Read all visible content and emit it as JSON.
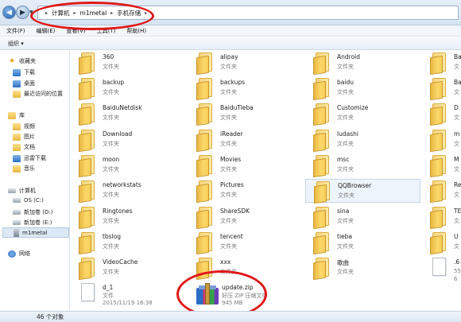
{
  "address": {
    "breadcrumbs": [
      "计算机",
      "m1metal",
      "手机存储"
    ]
  },
  "menu": [
    "文件(F)",
    "编辑(E)",
    "查看(V)",
    "工具(T)",
    "帮助(H)"
  ],
  "toolbar": {
    "organize_label": "组织 ▾"
  },
  "nav": {
    "favorites": "收藏夹",
    "download": "下载",
    "desktop": "桌面",
    "recent": "最近访问的位置",
    "library": "库",
    "video": "视频",
    "pictures": "图片",
    "docs": "文档",
    "xunlei": "迅雷下载",
    "music": "音乐",
    "computer": "计算机",
    "drive_c": "OS (C:)",
    "drive_d": "新加卷 (D:)",
    "drive_e": "新加卷 (E:)",
    "device": "m1metal",
    "network": "网络"
  },
  "items": [
    {
      "name": "360",
      "type": "文件夹"
    },
    {
      "name": "alipay",
      "type": "文件夹"
    },
    {
      "name": "Android",
      "type": "文件夹"
    },
    {
      "name": "Ba",
      "type": "文"
    },
    {
      "name": "backup",
      "type": "文件夹"
    },
    {
      "name": "backups",
      "type": "文件夹"
    },
    {
      "name": "baidu",
      "type": "文件夹"
    },
    {
      "name": "Ba",
      "type": "文"
    },
    {
      "name": "BaiduNetdisk",
      "type": "文件夹"
    },
    {
      "name": "BaiduTieba",
      "type": "文件夹"
    },
    {
      "name": "Customize",
      "type": "文件夹"
    },
    {
      "name": "D",
      "type": "文"
    },
    {
      "name": "Download",
      "type": "文件夹"
    },
    {
      "name": "iReader",
      "type": "文件夹"
    },
    {
      "name": "ludashi",
      "type": "文件夹"
    },
    {
      "name": "m",
      "type": "文"
    },
    {
      "name": "moon",
      "type": "文件夹"
    },
    {
      "name": "Movies",
      "type": "文件夹"
    },
    {
      "name": "msc",
      "type": "文件夹"
    },
    {
      "name": "M",
      "type": "文"
    },
    {
      "name": "networkstats",
      "type": "文件夹"
    },
    {
      "name": "Pictures",
      "type": "文件夹"
    },
    {
      "name": "QQBrowser",
      "type": "文件夹"
    },
    {
      "name": "Re",
      "type": "文"
    },
    {
      "name": "Ringtones",
      "type": "文件夹"
    },
    {
      "name": "ShareSDK",
      "type": "文件夹"
    },
    {
      "name": "sina",
      "type": "文件夹"
    },
    {
      "name": "TE",
      "type": "文"
    },
    {
      "name": "tbslog",
      "type": "文件夹"
    },
    {
      "name": "tencent",
      "type": "文件夹"
    },
    {
      "name": "tieba",
      "type": "文件夹"
    },
    {
      "name": "U",
      "type": "文"
    },
    {
      "name": "VideoCache",
      "type": "文件夹"
    },
    {
      "name": "xxx",
      "type": "文件夹"
    },
    {
      "name": "歌曲",
      "type": "文件夹"
    },
    {
      "name": ".6",
      "type": "55",
      "size": "6"
    }
  ],
  "file_d1": {
    "name": "d_1",
    "type": "文件",
    "date": "2015/11/19 16:38"
  },
  "file_update": {
    "name": "update.zip",
    "type": "好压 ZIP 压缩文件",
    "size": "945 MB"
  },
  "status": {
    "count_text": "46 个对象"
  },
  "colors": {
    "annotation": "#e01818",
    "folder": "#f6d47a",
    "selection": "#dce8f5"
  }
}
